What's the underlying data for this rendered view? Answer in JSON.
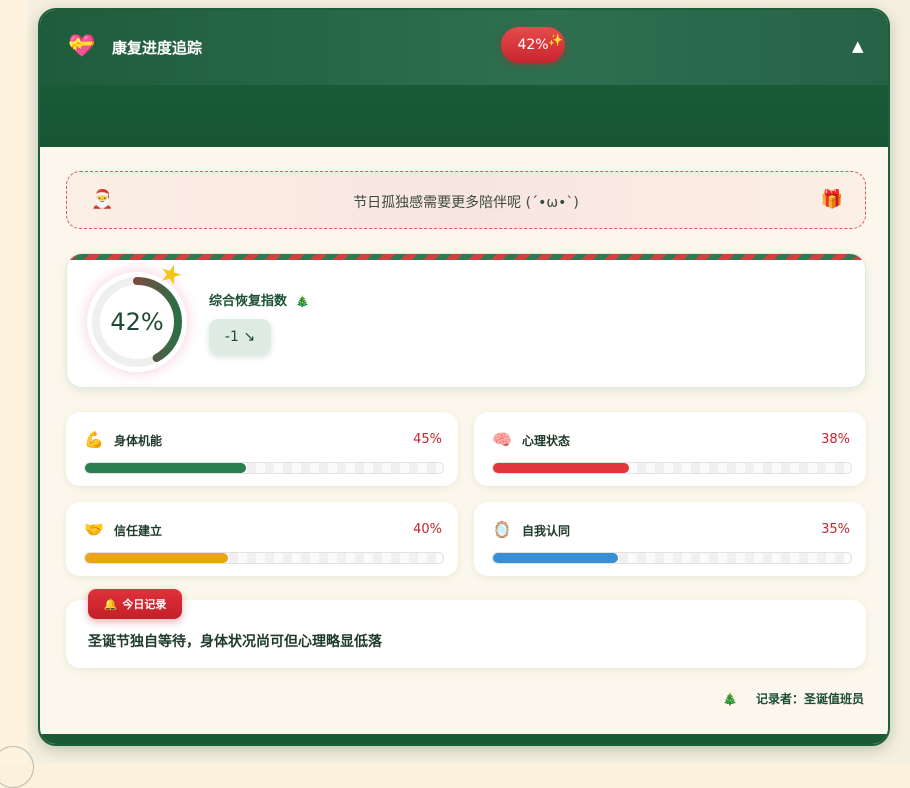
{
  "header": {
    "icon": "heart-ribbon-icon",
    "title": "康复进度追踪",
    "percent": "42%",
    "sparkle": "✨",
    "collapse_icon": "▲"
  },
  "notice": {
    "left_icon": "🎅",
    "text": "节日孤独感需要更多陪伴呢 (´•ω•`)",
    "right_icon": "🎁"
  },
  "score": {
    "value": 42,
    "percent_text": "42%",
    "label": "综合恢复指数",
    "label_icon": "🎄",
    "delta": "-1 ↘",
    "star_icon": "★"
  },
  "metrics": [
    {
      "icon": "💪",
      "label": "身体机能",
      "value": 45,
      "text": "45%",
      "color": "#2a7f50"
    },
    {
      "icon": "🧠",
      "label": "心理状态",
      "value": 38,
      "text": "38%",
      "color": "#e0363c"
    },
    {
      "icon": "🤝",
      "label": "信任建立",
      "value": 40,
      "text": "40%",
      "color": "#eaa417"
    },
    {
      "icon": "🪞",
      "label": "自我认同",
      "value": 35,
      "text": "35%",
      "color": "#3a8ed6"
    }
  ],
  "log": {
    "tag_icon": "🔔",
    "tag": "今日记录",
    "text": "圣诞节独自等待，身体状况尚可但心理略显低落"
  },
  "recorder": {
    "icon": "🎄",
    "text": "记录者：圣诞值班员"
  }
}
